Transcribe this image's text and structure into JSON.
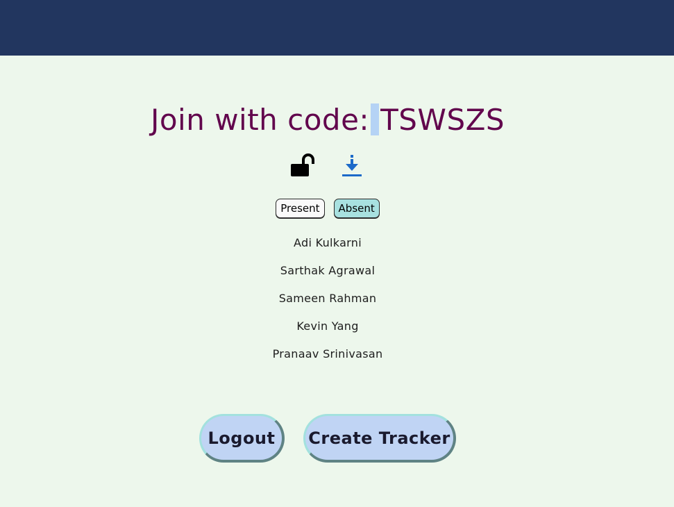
{
  "header": {
    "color": "#22365f"
  },
  "title": {
    "prefix": "Join with code:",
    "code": "TSWSZS",
    "color": "#62064d"
  },
  "icons": [
    "unlock-icon",
    "download-icon"
  ],
  "toggles": {
    "present_label": "Present",
    "absent_label": "Absent",
    "selected": "Absent"
  },
  "names": [
    "Adi Kulkarni",
    "Sarthak Agrawal",
    "Sameen Rahman",
    "Kevin Yang",
    "Pranaav Srinivasan"
  ],
  "buttons": {
    "logout_label": "Logout",
    "create_label": "Create Tracker"
  }
}
